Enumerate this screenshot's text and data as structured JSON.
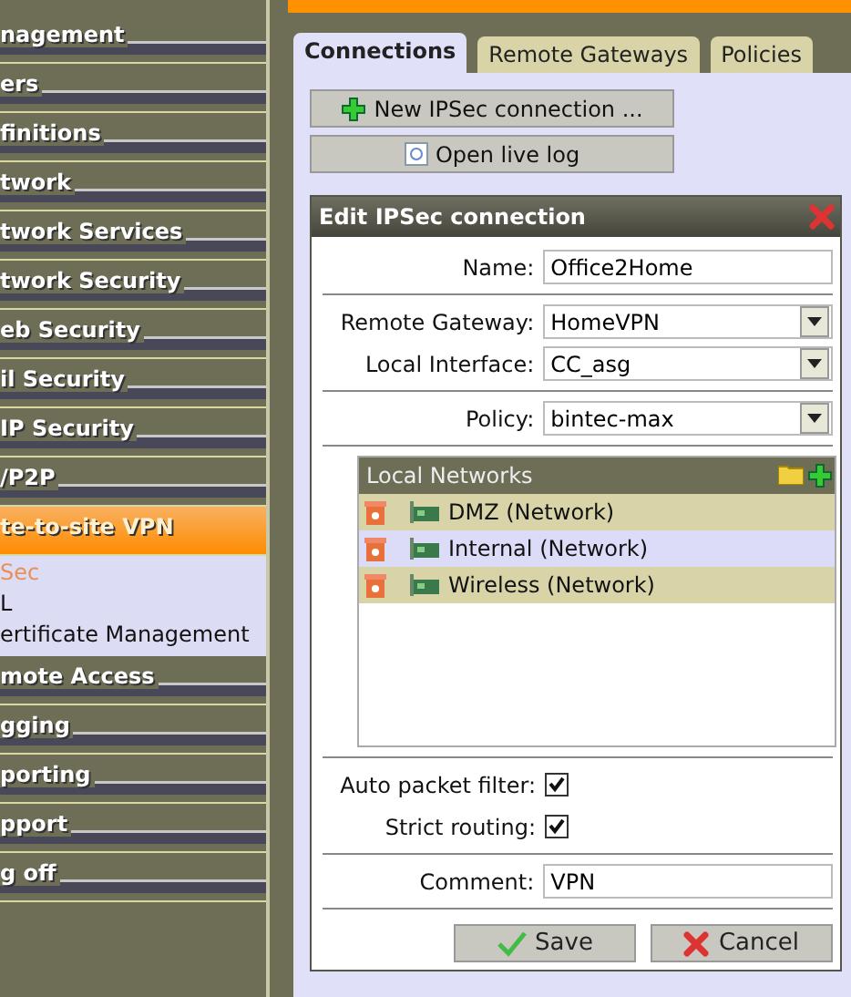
{
  "sidebar": {
    "items": [
      {
        "label": "nagement",
        "selected": false
      },
      {
        "label": "ers",
        "selected": false
      },
      {
        "label": "finitions",
        "selected": false
      },
      {
        "label": "twork",
        "selected": false
      },
      {
        "label": "twork Services",
        "selected": false
      },
      {
        "label": "twork Security",
        "selected": false
      },
      {
        "label": "eb Security",
        "selected": false
      },
      {
        "label": "il Security",
        "selected": false
      },
      {
        "label": "IP Security",
        "selected": false
      },
      {
        "label": "/P2P",
        "selected": false
      },
      {
        "label": "te-to-site VPN",
        "selected": true,
        "expanded": true,
        "children": [
          {
            "label": "Sec",
            "selected": true
          },
          {
            "label": "L",
            "selected": false
          },
          {
            "label": "ertificate Management",
            "selected": false
          }
        ]
      },
      {
        "label": "mote Access",
        "selected": false
      },
      {
        "label": "gging",
        "selected": false
      },
      {
        "label": "porting",
        "selected": false
      },
      {
        "label": "pport",
        "selected": false
      },
      {
        "label": "g off",
        "selected": false
      }
    ]
  },
  "tabs": [
    {
      "label": "Connections",
      "selected": true
    },
    {
      "label": "Remote Gateways",
      "selected": false
    },
    {
      "label": "Policies",
      "selected": false
    }
  ],
  "actions": [
    {
      "label": "New IPSec connection ...",
      "kind": "plus"
    },
    {
      "label": "Open live log",
      "kind": "log"
    }
  ],
  "dialog": {
    "title": "Edit IPSec connection",
    "fields": [
      {
        "kind": "text",
        "label": "Name:",
        "value": "Office2Home"
      },
      {
        "kind": "select",
        "label": "Remote Gateway:",
        "value": "HomeVPN"
      },
      {
        "kind": "select",
        "label": "Local Interface:",
        "value": "CC_asg"
      },
      {
        "kind": "select",
        "label": "Policy:",
        "value": "bintec-max"
      }
    ],
    "local_networks": {
      "title": "Local Networks",
      "items": [
        "DMZ (Network)",
        "Internal (Network)",
        "Wireless (Network)"
      ]
    },
    "options": [
      {
        "label": "Auto packet filter:",
        "checked": true
      },
      {
        "label": "Strict routing:",
        "checked": true
      }
    ],
    "comment": {
      "label": "Comment:",
      "value": "VPN"
    },
    "buttons": [
      {
        "label": "Save",
        "kind": "save"
      },
      {
        "label": "Cancel",
        "kind": "cancel"
      }
    ]
  }
}
